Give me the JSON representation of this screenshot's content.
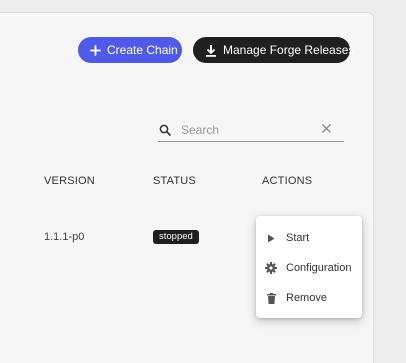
{
  "toolbar": {
    "create_chain_label": "Create Chain",
    "manage_forge_label": "Manage Forge Releases"
  },
  "search": {
    "placeholder": "Search",
    "value": ""
  },
  "table": {
    "headers": [
      "VERSION",
      "STATUS",
      "ACTIONS"
    ],
    "rows": [
      {
        "version": "1.1.1-p0",
        "status": "stopped"
      }
    ]
  },
  "actions_menu": {
    "items": [
      {
        "label": "Start",
        "icon": "play-icon"
      },
      {
        "label": "Configuration",
        "icon": "gear-icon"
      },
      {
        "label": "Remove",
        "icon": "trash-icon"
      }
    ]
  },
  "colors": {
    "primary": "#4f5ae6",
    "dark_button": "#202020",
    "badge": "#1f1f1f",
    "panel": "#f6f6f6"
  }
}
